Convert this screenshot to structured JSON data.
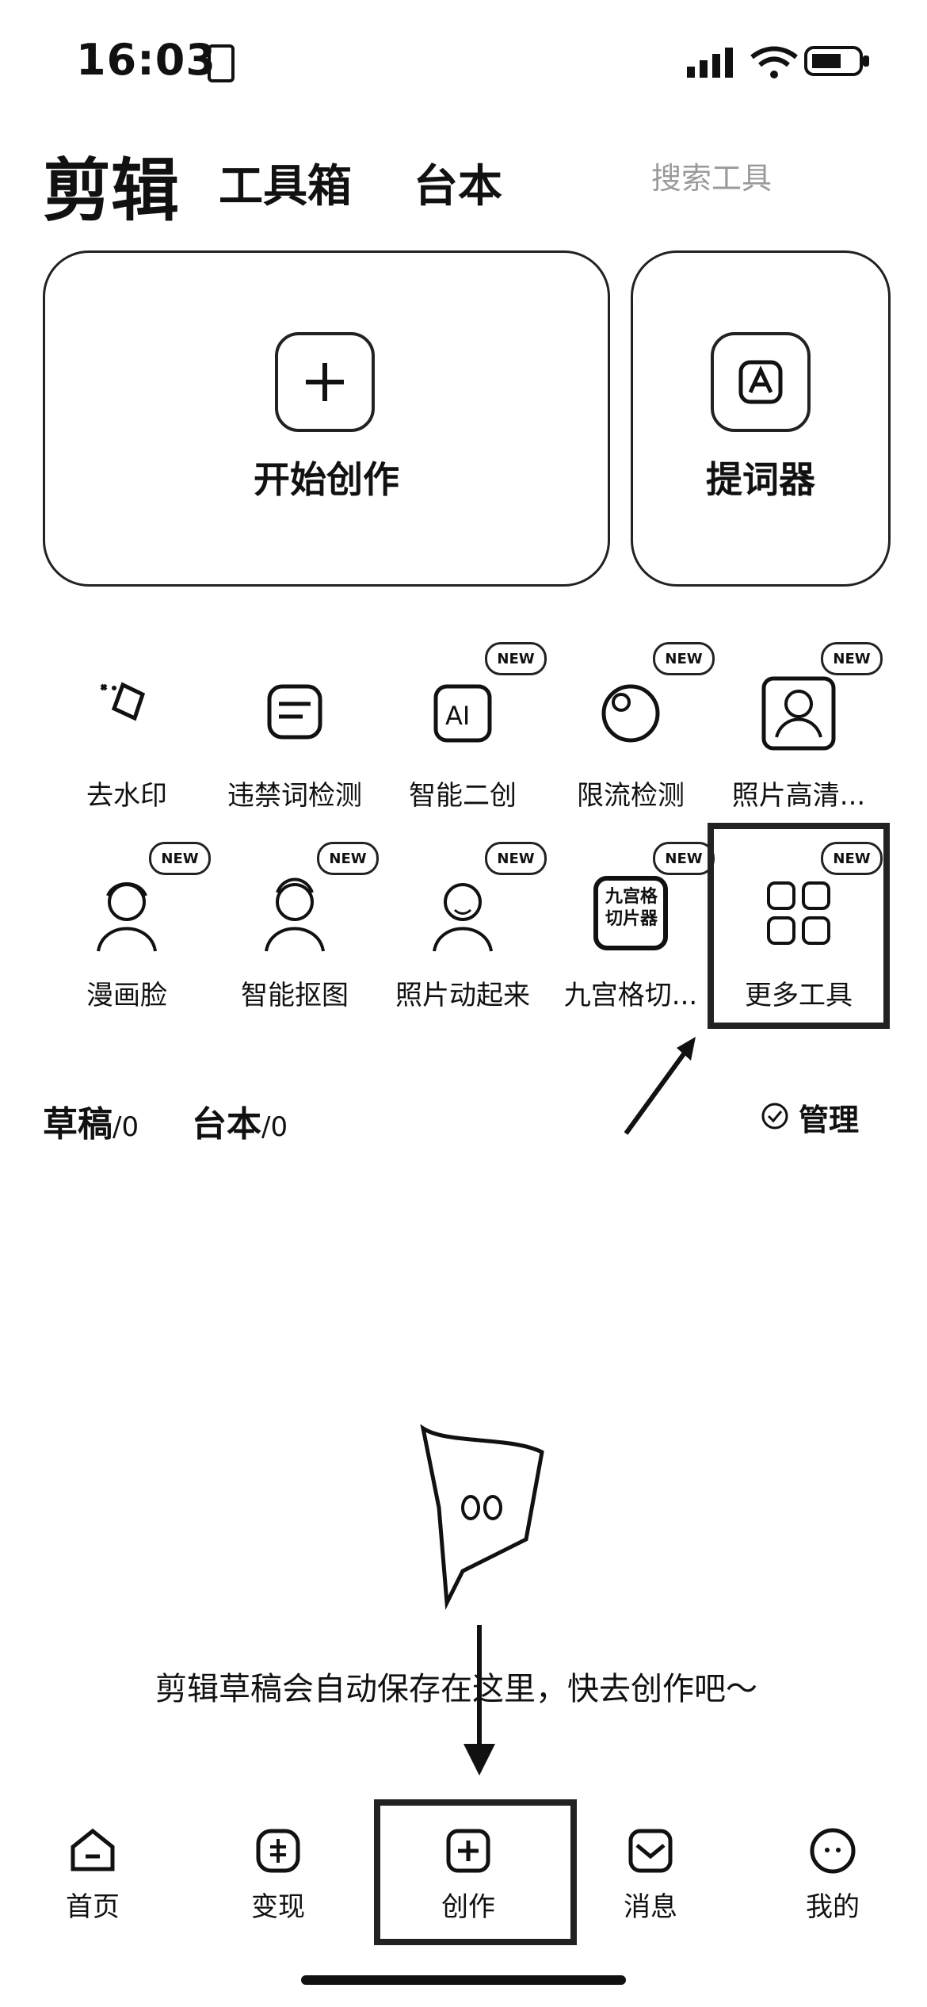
{
  "status_bar": {
    "time": "16:03",
    "signal": "signal-icon",
    "wifi": "wifi-icon",
    "battery": "battery-icon"
  },
  "header": {
    "tabs": [
      {
        "label": "剪辑"
      },
      {
        "label": "工具箱"
      },
      {
        "label": "台本"
      }
    ],
    "search_text": "搜索工具"
  },
  "cards": [
    {
      "label": "开始创作"
    },
    {
      "label": "提词器"
    }
  ],
  "tools": [
    {
      "label": "去水印",
      "icon": "watermark-icon",
      "new": false
    },
    {
      "label": "违禁词检测",
      "icon": "text-check-icon",
      "new": false
    },
    {
      "label": "智能二创",
      "icon": "ai-icon",
      "new": true
    },
    {
      "label": "限流检测",
      "icon": "circle-icon",
      "new": true
    },
    {
      "label": "照片高清...",
      "icon": "photo-hd-icon",
      "new": true
    },
    {
      "label": "漫画脸",
      "icon": "comic-face-icon",
      "new": true
    },
    {
      "label": "智能抠图",
      "icon": "cutout-icon",
      "new": true
    },
    {
      "label": "照片动起来",
      "icon": "photo-motion-icon",
      "new": true
    },
    {
      "label": "九宫格切...",
      "icon": "grid-cut-icon",
      "new": true,
      "badge_text": "九宫格切片器"
    },
    {
      "label": "更多工具",
      "icon": "more-tools-icon",
      "new": true
    }
  ],
  "new_badge": "NEW",
  "drafts": {
    "label": "草稿",
    "count": "/0",
    "script_label": "台本",
    "script_count": "/0",
    "manage": "管理"
  },
  "empty_state": {
    "message": "剪辑草稿会自动保存在这里，快去创作吧～"
  },
  "nav": [
    {
      "label": "首页",
      "icon": "home-icon"
    },
    {
      "label": "变现",
      "icon": "monetize-icon"
    },
    {
      "label": "创作",
      "icon": "create-icon"
    },
    {
      "label": "消息",
      "icon": "message-icon"
    },
    {
      "label": "我的",
      "icon": "profile-icon"
    }
  ],
  "colors": {
    "primary": "#111111",
    "background": "#ffffff",
    "muted": "#9a9a9a"
  }
}
